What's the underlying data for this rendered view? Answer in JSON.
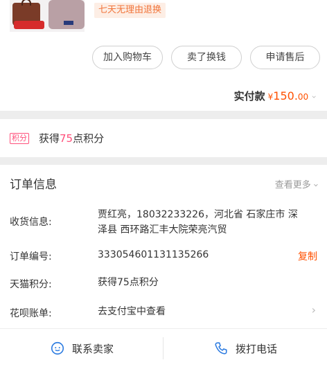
{
  "product": {
    "return_tag": "七天无理由退换"
  },
  "actions": {
    "add_to_cart": "加入购物车",
    "sell_for_cash": "卖了换钱",
    "after_sale": "申请售后"
  },
  "total": {
    "label": "实付款",
    "currency": "¥",
    "amount": "150.",
    "decimal": "00"
  },
  "points": {
    "badge": "积分",
    "text_prefix": "获得",
    "value": "75",
    "text_suffix": "点积分"
  },
  "order": {
    "title": "订单信息",
    "more": "查看更多",
    "rows": [
      {
        "label": "收货信息:",
        "value_line1": "贾红亮，18032233226，河北省 石家庄市 深",
        "value_line2": "泽县 西环路汇丰大院荣亮汽贸"
      },
      {
        "label": "订单编号:",
        "value": "333054601131135266",
        "action": "复制"
      },
      {
        "label": "天猫积分:",
        "value": "获得75点积分"
      },
      {
        "label": "花呗账单:",
        "value": "去支付宝中查看"
      }
    ]
  },
  "footer": {
    "contact": "联系卖家",
    "call": "拨打电话"
  },
  "colors": {
    "accent": "#ff5000",
    "points": "#ff4f7a"
  }
}
